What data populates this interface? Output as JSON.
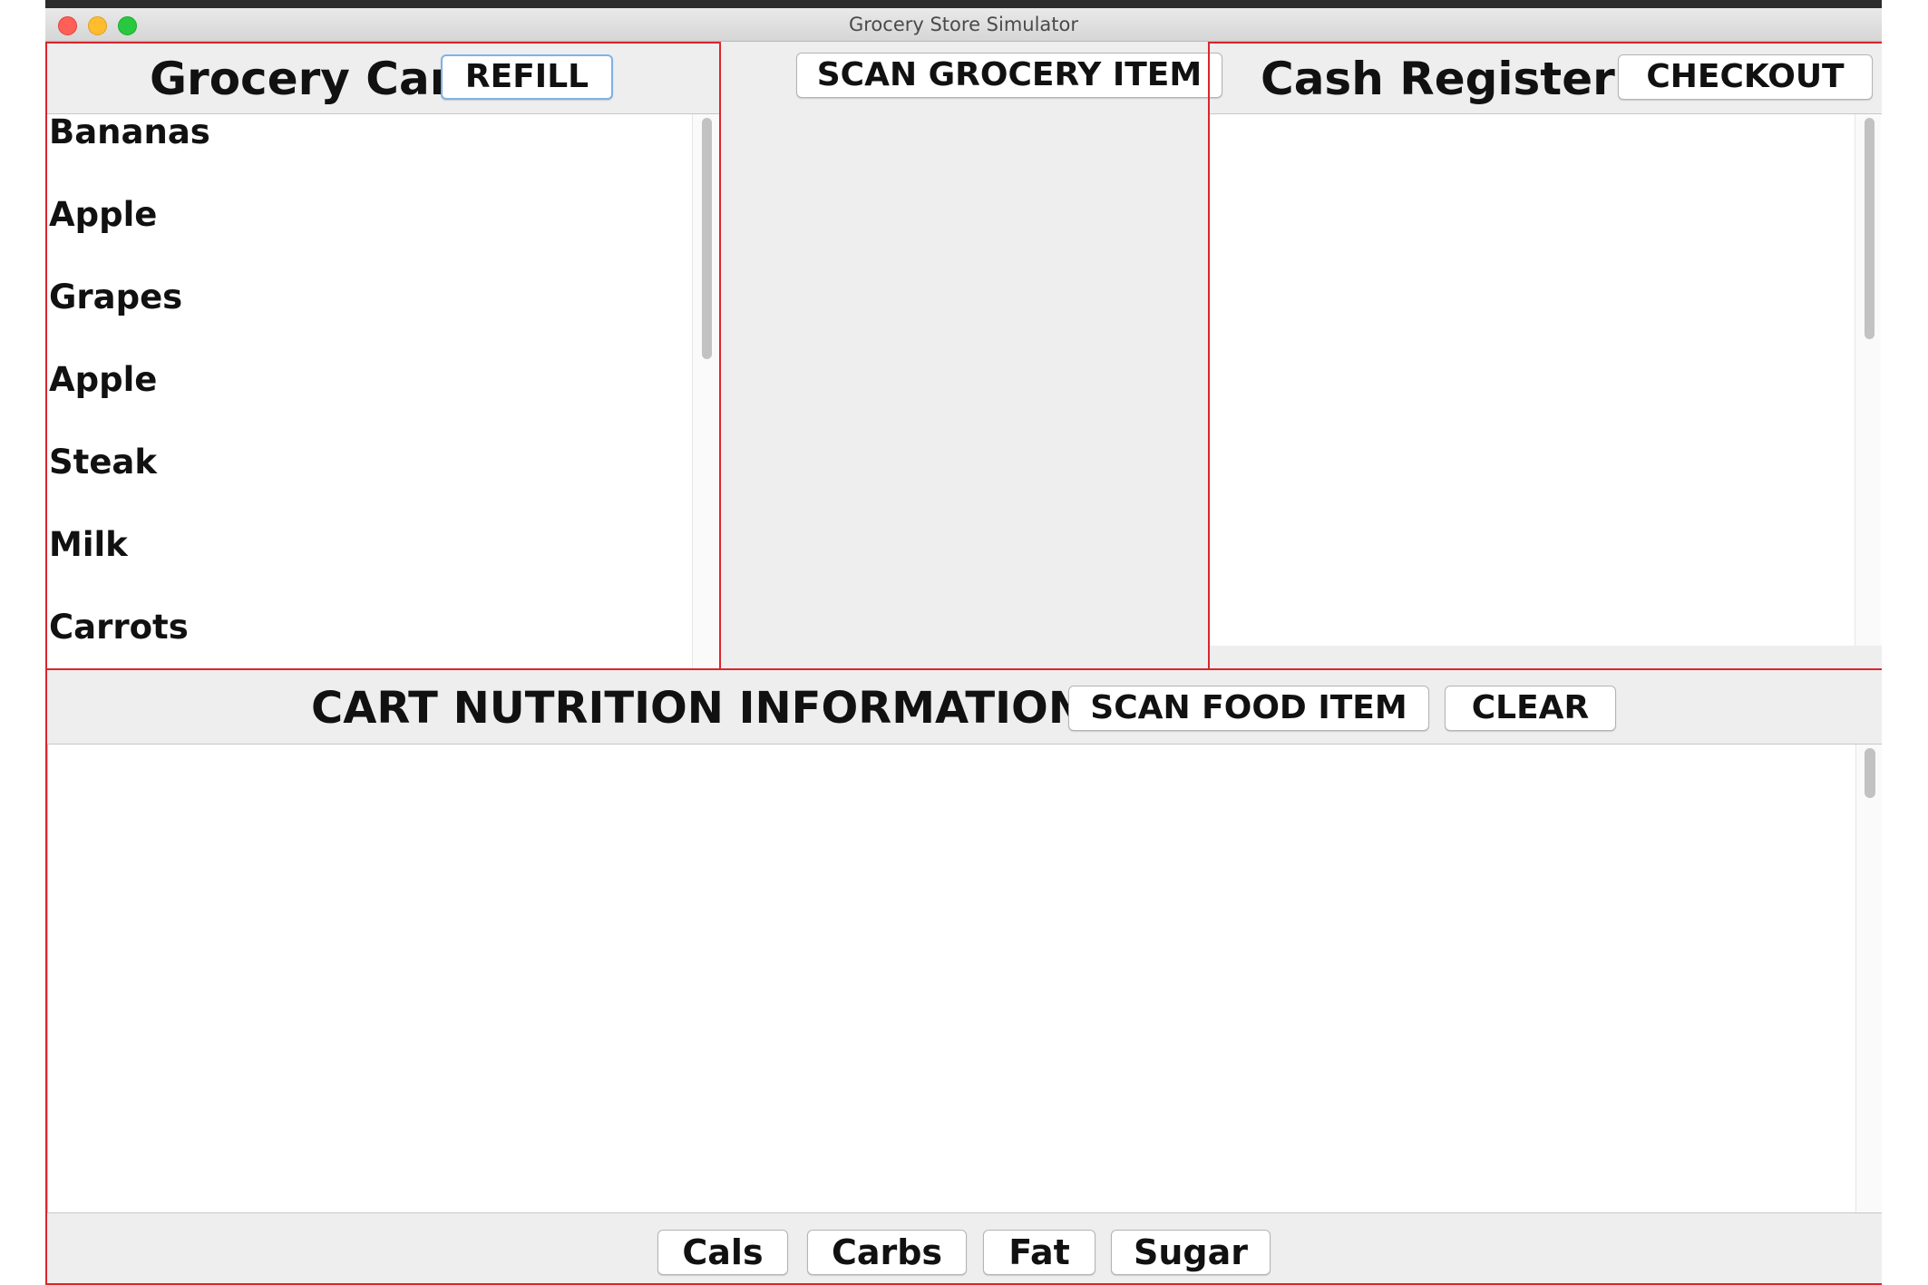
{
  "window": {
    "title": "Grocery Store Simulator"
  },
  "grocery_cart": {
    "heading": "Grocery Cart",
    "refill_label": "REFILL",
    "items": [
      "Bananas",
      "Apple",
      "Grapes",
      "Apple",
      "Steak",
      "Milk",
      "Carrots"
    ]
  },
  "scanner": {
    "scan_grocery_label": "SCAN GROCERY ITEM"
  },
  "cash_register": {
    "heading": "Cash Register",
    "checkout_label": "CHECKOUT"
  },
  "nutrition": {
    "heading": "CART NUTRITION INFORMATION",
    "scan_food_label": "SCAN FOOD ITEM",
    "clear_label": "CLEAR",
    "sort_buttons": [
      "Cals",
      "Carbs",
      "Fat",
      "Sugar"
    ]
  },
  "colors": {
    "panel_border": "#d9262c",
    "focus_ring": "#7fb1e6",
    "background": "#eeeeee"
  }
}
